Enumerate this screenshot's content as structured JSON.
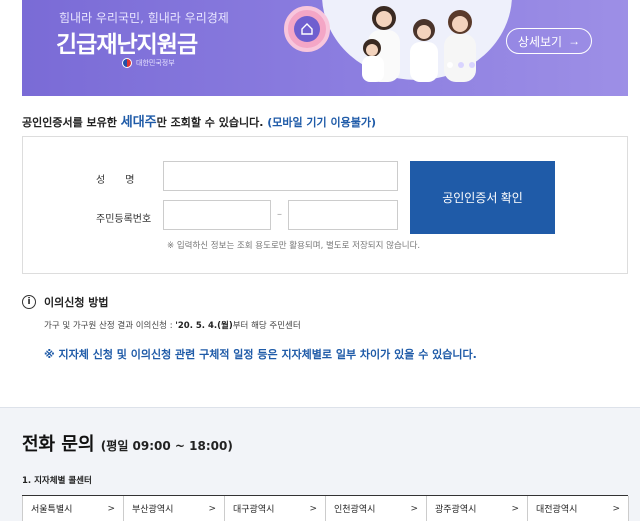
{
  "banner": {
    "subtitle": "힘내라 우리국민, 힘내라 우리경제",
    "title": "긴급재난지원금",
    "gov_label": "대한민국정부",
    "detail_button": "상세보기",
    "detail_arrow": "→"
  },
  "notice": {
    "prefix": "공인인증서를 보유한 ",
    "emphasis": "세대주",
    "middle": "만 조회할 수 있습니다. ",
    "mobile": "(모바일 기기 이용불가)"
  },
  "form": {
    "name_label": "성　　명",
    "rrn_label": "주민등록번호",
    "name_value": "",
    "rrn_front_value": "",
    "rrn_back_value": "",
    "dash": "–",
    "cert_button": "공인인증서 확인",
    "note": "※ 입력하신 정보는 조회 용도로만 활용되며, 별도로 저장되지 않습니다."
  },
  "objection": {
    "icon": "i",
    "title": "이의신청 방법",
    "desc_prefix": "가구 및 가구원 산정 결과 이의신청 : ",
    "desc_date": "'20. 5. 4.(월)",
    "desc_suffix": "부터 해당 주민센터",
    "warning": "※ 지자체 신청 및 이의신청 관련 구체적 일정 등은 지자체별로 일부 차이가 있을 수 있습니다."
  },
  "phone": {
    "title": "전화 문의",
    "hours": "(평일 09:00 ~ 18:00)",
    "region_heading": "1. 지자체별 콜센터",
    "regions": [
      {
        "name": "서울특별시",
        "arrow": ">"
      },
      {
        "name": "부산광역시",
        "arrow": ">"
      },
      {
        "name": "대구광역시",
        "arrow": ">"
      },
      {
        "name": "인천광역시",
        "arrow": ">"
      },
      {
        "name": "광주광역시",
        "arrow": ">"
      },
      {
        "name": "대전광역시",
        "arrow": ">"
      }
    ]
  },
  "colors": {
    "banner": "#7a6bd6",
    "primary_blue": "#1f5ba8"
  }
}
